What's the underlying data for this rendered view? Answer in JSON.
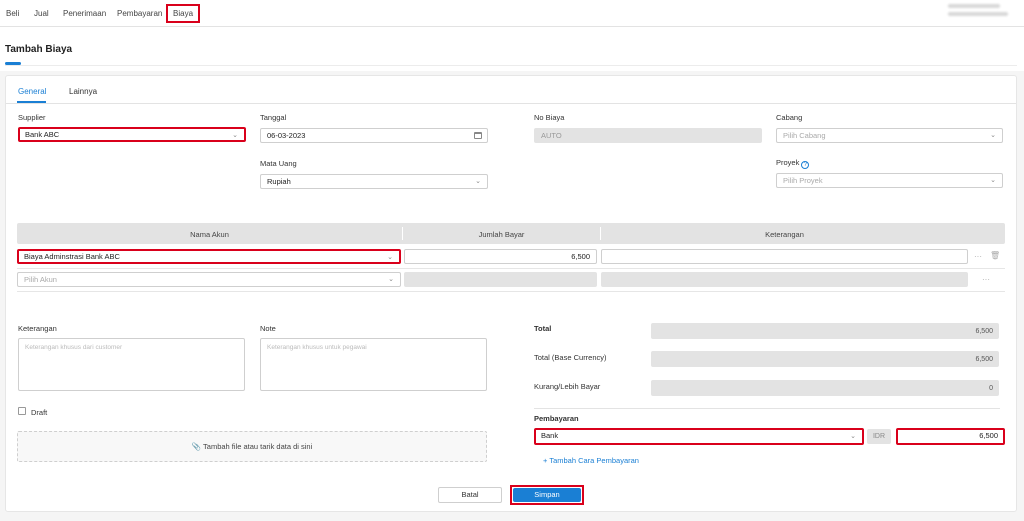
{
  "nav": {
    "items": [
      "Beli",
      "Jual",
      "Penerimaan",
      "Pembayaran",
      "Biaya"
    ],
    "active": "Biaya"
  },
  "page": {
    "title": "Tambah Biaya"
  },
  "tabs": [
    "General",
    "Lainnya"
  ],
  "form": {
    "supplier": {
      "label": "Supplier",
      "value": "Bank ABC"
    },
    "tanggal": {
      "label": "Tanggal",
      "value": "06-03-2023"
    },
    "no_biaya": {
      "label": "No Biaya",
      "value": "AUTO"
    },
    "cabang": {
      "label": "Cabang",
      "placeholder": "Pilih Cabang"
    },
    "mata_uang": {
      "label": "Mata Uang",
      "value": "Rupiah"
    },
    "proyek": {
      "label": "Proyek",
      "placeholder": "Pilih Proyek",
      "help": "?"
    }
  },
  "table": {
    "headers": [
      "Nama Akun",
      "Jumlah Bayar",
      "Keterangan"
    ],
    "rows": [
      {
        "akun": "Biaya Adminstrasi Bank ABC",
        "jumlah": "6,500",
        "keterangan": ""
      }
    ],
    "new_row_placeholder": "Pilih Akun",
    "more_symbol": "···",
    "trash_symbol": "🗑"
  },
  "notes": {
    "keterangan_label": "Keterangan",
    "keterangan_placeholder": "Keterangan khusus dari customer",
    "note_label": "Note",
    "note_placeholder": "Keterangan khusus untuk pegawai",
    "draft_label": "Draft",
    "attach_label": "Tambah file atau tarik data di sini"
  },
  "summary": {
    "total_label": "Total",
    "total_value": "6,500",
    "total_base_label": "Total (Base Currency)",
    "total_base_value": "6,500",
    "kurang_label": "Kurang/Lebih Bayar",
    "kurang_value": "0"
  },
  "payment": {
    "label": "Pembayaran",
    "method": "Bank",
    "currency": "IDR",
    "amount": "6,500",
    "add_label": "+ Tambah Cara Pembayaran"
  },
  "actions": {
    "cancel": "Batal",
    "save": "Simpan"
  },
  "colors": {
    "accent": "#1a7fd4",
    "highlight": "#d9001b"
  }
}
